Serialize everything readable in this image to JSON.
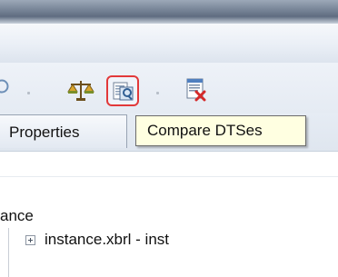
{
  "toolbar": {
    "items": [
      {
        "icon": "search-icon",
        "tooltip": ""
      },
      {
        "icon": "scales-icon",
        "tooltip": ""
      },
      {
        "icon": "compare-dtses-icon",
        "tooltip": "Compare DTSes",
        "state": "hover"
      },
      {
        "icon": "delete-list-icon",
        "tooltip": ""
      }
    ]
  },
  "tabs": {
    "properties_label": "Properties"
  },
  "tooltip": {
    "text": "Compare DTSes"
  },
  "tree": {
    "root_label": "ance",
    "items": [
      {
        "label": "instance.xbrl - inst",
        "expander": "+"
      }
    ]
  },
  "colors": {
    "tooltip_bg": "#ffffe1",
    "hover_border": "#e2393a",
    "toolbar_bg": "#e8edf5"
  }
}
